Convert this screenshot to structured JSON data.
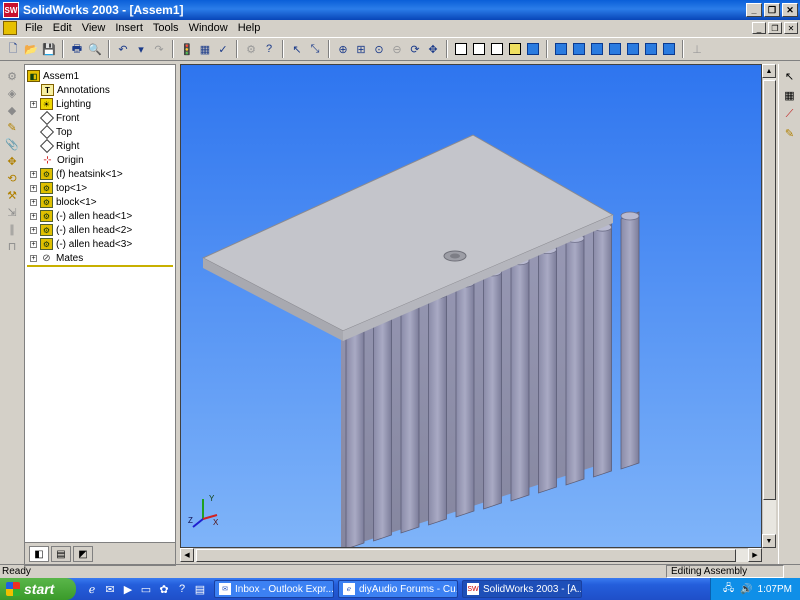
{
  "window": {
    "title": "SolidWorks 2003 - [Assem1]",
    "logo_text": "SW"
  },
  "menu": [
    "File",
    "Edit",
    "View",
    "Insert",
    "Tools",
    "Window",
    "Help"
  ],
  "tree": {
    "items": [
      {
        "label": "Assem1",
        "icon": "assembly-icon"
      },
      {
        "label": "Annotations",
        "icon": "annotations-icon"
      },
      {
        "label": "Lighting",
        "icon": "lighting-icon"
      },
      {
        "label": "Front",
        "icon": "plane-icon"
      },
      {
        "label": "Top",
        "icon": "plane-icon"
      },
      {
        "label": "Right",
        "icon": "plane-icon"
      },
      {
        "label": "Origin",
        "icon": "origin-icon"
      },
      {
        "label": "(f) heatsink<1>",
        "icon": "part-icon"
      },
      {
        "label": "top<1>",
        "icon": "part-icon"
      },
      {
        "label": "block<1>",
        "icon": "part-icon"
      },
      {
        "label": "(-) allen head<1>",
        "icon": "part-icon"
      },
      {
        "label": "(-) allen head<2>",
        "icon": "part-icon"
      },
      {
        "label": "(-) allen head<3>",
        "icon": "part-icon"
      },
      {
        "label": "Mates",
        "icon": "mates-icon"
      }
    ]
  },
  "triad": {
    "x": "X",
    "y": "Y",
    "z": "Z"
  },
  "status": {
    "left": "Ready",
    "mode": "Editing Assembly"
  },
  "taskbar": {
    "start": "start",
    "tasks": [
      {
        "label": "Inbox - Outlook Expr..."
      },
      {
        "label": "diyAudio Forums - Cu..."
      },
      {
        "label": "SolidWorks 2003 - [A..."
      }
    ],
    "clock": "1:07PM"
  },
  "colors": {
    "viewport_top": "#2e75ef",
    "viewport_bottom": "#7fb4f9",
    "title_blue": "#0a5fd8",
    "taskbar_blue": "#245edb"
  }
}
